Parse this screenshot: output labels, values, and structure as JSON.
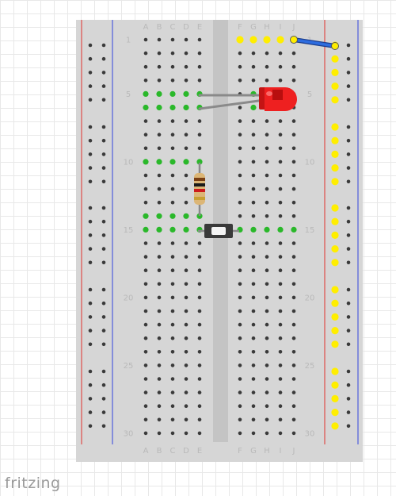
{
  "app": {
    "brand": "fritzing"
  },
  "breadboard": {
    "column_letters_left": [
      "A",
      "B",
      "C",
      "D",
      "E"
    ],
    "column_letters_right": [
      "F",
      "G",
      "H",
      "I",
      "J"
    ],
    "row_numbers": [
      "1",
      "5",
      "10",
      "15",
      "20",
      "25",
      "30"
    ],
    "rows": 30
  },
  "connected_holes": {
    "left_rows": [
      5,
      6,
      10,
      14,
      15
    ],
    "right_top_row": 1
  },
  "components": {
    "led": {
      "color": "#ee2020"
    },
    "resistor": {
      "bands": [
        "brown",
        "black",
        "red",
        "gold"
      ]
    },
    "jumper_wire": {
      "color": "#2d6cdf"
    },
    "pushbutton": "pushbutton"
  },
  "colors": {
    "board": "#d6d6d6",
    "rail_red": "#e0332e",
    "rail_blue": "#3344dd",
    "hole_connected_green": "#2ab82a",
    "hole_connected_yellow": "#ffee00"
  }
}
